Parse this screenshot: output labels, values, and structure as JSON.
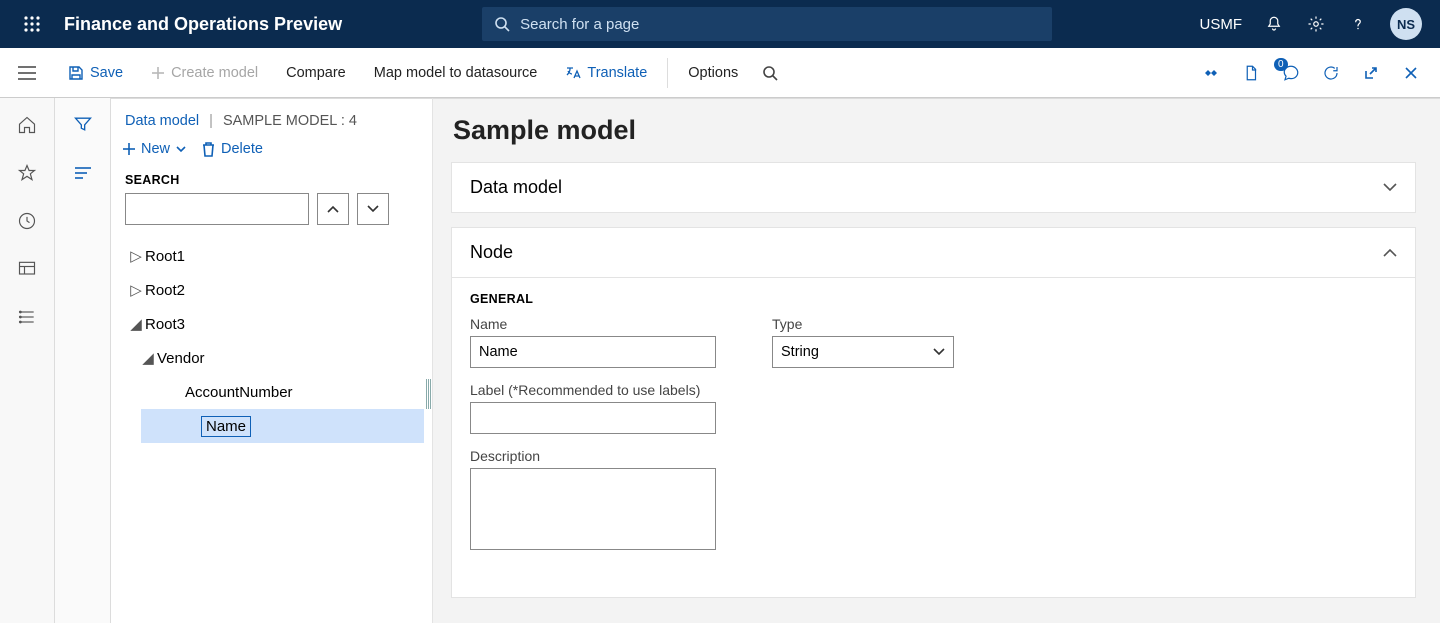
{
  "header": {
    "app_title": "Finance and Operations Preview",
    "search_placeholder": "Search for a page",
    "company": "USMF",
    "avatar_initials": "NS"
  },
  "actionbar": {
    "save": "Save",
    "create_model": "Create model",
    "compare": "Compare",
    "map_model": "Map model to datasource",
    "translate": "Translate",
    "options": "Options",
    "badge": "0"
  },
  "crumbs": {
    "root": "Data model",
    "current": "SAMPLE MODEL : 4"
  },
  "tree_toolbar": {
    "new": "New",
    "delete": "Delete",
    "search_label": "SEARCH"
  },
  "tree": {
    "root1": "Root1",
    "root2": "Root2",
    "root3": "Root3",
    "vendor": "Vendor",
    "account_number": "AccountNumber",
    "name": "Name"
  },
  "content": {
    "title": "Sample model",
    "panel_datamodel": "Data model",
    "panel_node": "Node",
    "section_general": "GENERAL",
    "field_name_label": "Name",
    "field_name_value": "Name",
    "field_label_label": "Label (*Recommended to use labels)",
    "field_label_value": "",
    "field_desc_label": "Description",
    "field_desc_value": "",
    "field_type_label": "Type",
    "field_type_value": "String"
  }
}
